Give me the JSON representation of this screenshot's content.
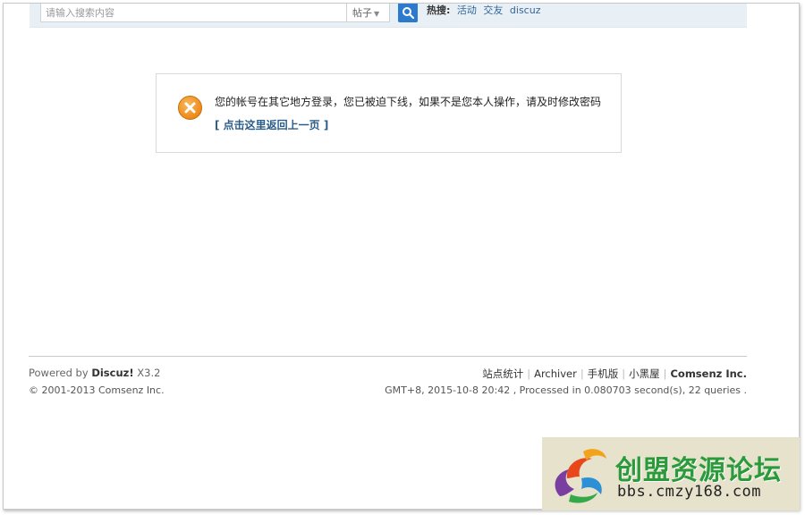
{
  "search": {
    "placeholder": "请输入搜索内容",
    "type_label": "帖子",
    "hot_label": "热搜:",
    "hot_links": [
      "活动",
      "交友",
      "discuz"
    ]
  },
  "message": {
    "text": "您的帐号在其它地方登录，您已被迫下线，如果不是您本人操作，请及时修改密码",
    "back_link": "[ 点击这里返回上一页 ]"
  },
  "footer": {
    "powered_prefix": "Powered by",
    "powered_brand": "Discuz!",
    "powered_version": "X3.2",
    "copyright": "© 2001-2013 Comsenz Inc.",
    "nav": [
      "站点统计",
      "Archiver",
      "手机版",
      "小黑屋"
    ],
    "company": "Comsenz Inc.",
    "stats": "GMT+8, 2015-10-8 20:42 , Processed in 0.080703 second(s), 22 queries ."
  },
  "watermark": {
    "title": "创盟资源论坛",
    "url": "bbs.cmzy168.com"
  },
  "colors": {
    "accent": "#2b7acd",
    "link": "#2a5d8a",
    "warning_icon": "#ee8a1a",
    "watermark_green": "#2a9a3a"
  }
}
